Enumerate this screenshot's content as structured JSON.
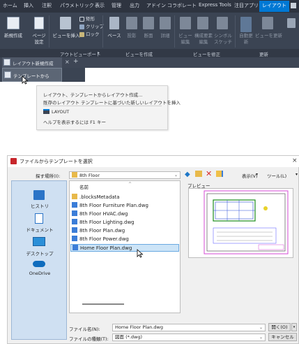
{
  "ribbon": {
    "tabs": [
      "ホーム",
      "挿入",
      "注釈",
      "パラメトリック",
      "表示",
      "管理",
      "出力",
      "アドイン",
      "コラボレート",
      "Express Tools",
      "注目アプリ",
      "レイアウト"
    ],
    "active_tab": "レイアウト",
    "buttons": {
      "new_layout": "新規作成",
      "page_setup": "ページ設定",
      "insert_view": "ビューを挿入",
      "rectangular": "矩形",
      "clip": "クリップ",
      "lock": "ロック",
      "base": "ベース",
      "projected": "投影",
      "section": "断面",
      "detail": "詳細",
      "edit_view": "ビュー編集",
      "edit_components": "構成要素編集",
      "symbol_sketch": "シンボルスケッチ",
      "auto_update": "自動更新",
      "update_view": "ビューを更新"
    },
    "panels": {
      "layout_viewport": "アウトビューポート",
      "create_view": "ビューを作成",
      "modify_view": "ビューを修正",
      "update": "更新"
    }
  },
  "doc_tabs": {
    "new_layout_menu": "レイアウト新規作成",
    "close": "×",
    "add": "+"
  },
  "dropdown": {
    "from_template": "テンプレートから"
  },
  "tooltip": {
    "line1": "レイアウト、テンプレートからレイアウト作成...",
    "line2": "既存のレイアウト テンプレートに基づいた新しいレイアウトを挿入",
    "command": "LAYOUT",
    "help": "ヘルプを表示するには F1 キー"
  },
  "dialog": {
    "title": "ファイルからテンプレートを選択",
    "close": "×",
    "look_in_label": "探す場所(I):",
    "look_in_value": "8th Floor",
    "views_label": "表示(V)",
    "tools_label": "ツール(L)",
    "preview_label": "プレビュー",
    "places": [
      "ヒストリ",
      "ドキュメント",
      "デスクトップ",
      "OneDrive"
    ],
    "column_name": "名前",
    "files": [
      ".blocksMetadata",
      "8th Floor Furniture Plan.dwg",
      "8th Floor HVAC.dwg",
      "8th Floor Lighting.dwg",
      "8th Floor Plan.dwg",
      "8th Floor Power.dwg",
      "Home Floor Plan.dwg"
    ],
    "selected_file": "Home Floor Plan.dwg",
    "filename_label": "ファイル名(N):",
    "filename_value": "Home Floor Plan.dwg",
    "filetype_label": "ファイルの種類(T):",
    "filetype_value": "図面 (*.dwg)",
    "open_button": "開く(O)",
    "cancel_button": "キャンセル"
  },
  "colors": {
    "accent": "#0078d4",
    "ribbon_bg": "#3b4453",
    "places_bg": "#cfe0f2",
    "selection": "#cce4f7"
  }
}
